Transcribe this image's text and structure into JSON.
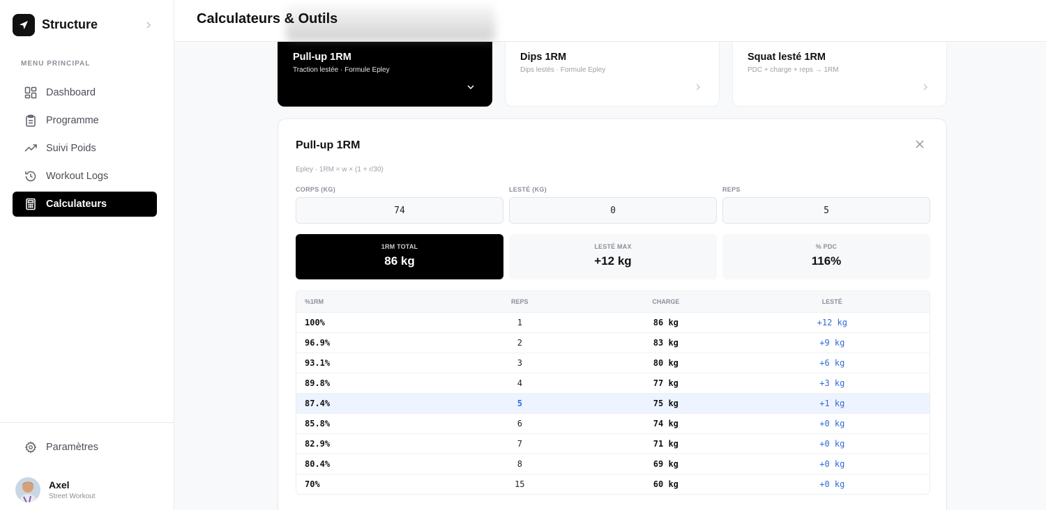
{
  "sidebar": {
    "brand": "Structure",
    "menu_title": "MENU PRINCIPAL",
    "items": [
      {
        "label": "Dashboard",
        "icon": "dashboard-grid-icon"
      },
      {
        "label": "Programme",
        "icon": "clipboard-icon"
      },
      {
        "label": "Suivi Poids",
        "icon": "trending-up-icon"
      },
      {
        "label": "Workout Logs",
        "icon": "history-icon"
      },
      {
        "label": "Calculateurs",
        "icon": "calculator-icon",
        "active": true
      }
    ],
    "settings_label": "Paramètres",
    "user": {
      "name": "Axel",
      "subtitle": "Street Workout"
    }
  },
  "header": {
    "title": "Calculateurs & Outils"
  },
  "cards": [
    {
      "title": "Pull-up 1RM",
      "subtitle": "Traction lestée · Formule Epley",
      "active": true
    },
    {
      "title": "Dips 1RM",
      "subtitle": "Dips lestés · Formule Epley",
      "active": false
    },
    {
      "title": "Squat lesté 1RM",
      "subtitle": "PDC + charge + reps → 1RM",
      "active": false
    }
  ],
  "panel": {
    "title": "Pull-up 1RM",
    "formula": "Epley · 1RM = w × (1 + r/30)",
    "fields": [
      {
        "label": "CORPS (KG)",
        "value": "74"
      },
      {
        "label": "LESTÉ (KG)",
        "value": "0"
      },
      {
        "label": "REPS",
        "value": "5"
      }
    ],
    "stats": [
      {
        "label": "1RM TOTAL",
        "value": "86 kg"
      },
      {
        "label": "LESTÉ MAX",
        "value": "+12 kg"
      },
      {
        "label": "% PDC",
        "value": "116%"
      }
    ],
    "table": {
      "headers": [
        "%1RM",
        "REPS",
        "CHARGE",
        "LESTÉ"
      ],
      "rows": [
        [
          "100%",
          "1",
          "86 kg",
          "+12 kg"
        ],
        [
          "96.9%",
          "2",
          "83 kg",
          "+9 kg"
        ],
        [
          "93.1%",
          "3",
          "80 kg",
          "+6 kg"
        ],
        [
          "89.8%",
          "4",
          "77 kg",
          "+3 kg"
        ],
        [
          "87.4%",
          "5",
          "75 kg",
          "+1 kg"
        ],
        [
          "85.8%",
          "6",
          "74 kg",
          "+0 kg"
        ],
        [
          "82.9%",
          "7",
          "71 kg",
          "+0 kg"
        ],
        [
          "80.4%",
          "8",
          "69 kg",
          "+0 kg"
        ],
        [
          "70%",
          "15",
          "60 kg",
          "+0 kg"
        ]
      ],
      "highlight_row": 4
    }
  },
  "colors": {
    "accent": "#2f6bd8",
    "active_bg": "#000000",
    "highlight_row": "#eef4ff"
  }
}
